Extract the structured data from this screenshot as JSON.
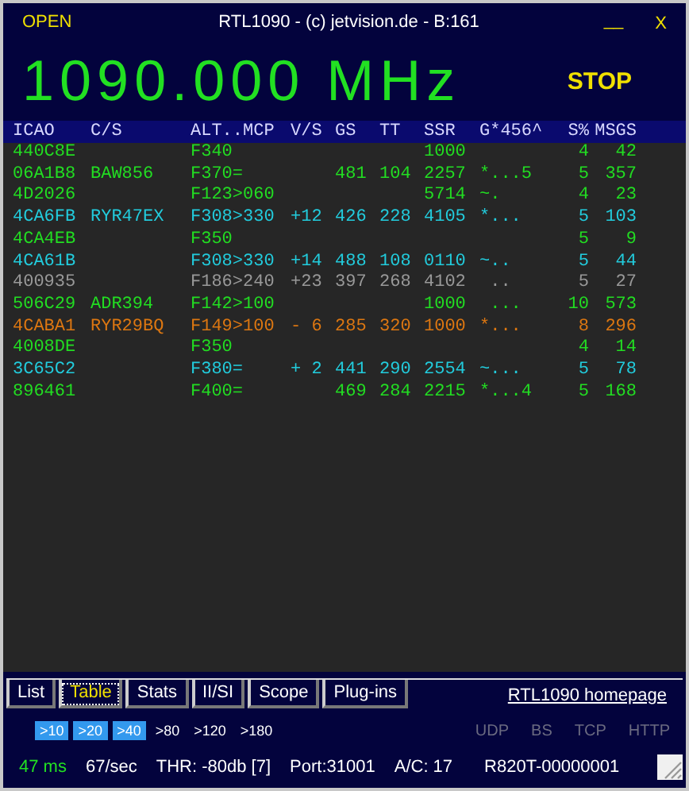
{
  "window": {
    "title": "RTL1090 - (c) jetvision.de - B:161",
    "open_label": "OPEN",
    "minimize_label": "__",
    "close_label": "X"
  },
  "frequency": "1090.000 MHz",
  "stop_label": "STOP",
  "table": {
    "columns": [
      "ICAO",
      "C/S",
      "ALT..MCP",
      "V/S",
      "GS",
      "TT",
      "SSR",
      "G*456^",
      "S%",
      "MSGS"
    ],
    "rows": [
      {
        "color": "#22dd22",
        "cells": [
          "440C8E",
          "",
          "F340",
          "",
          "",
          "",
          "1000",
          "",
          "4",
          "42"
        ]
      },
      {
        "color": "#22dd22",
        "cells": [
          "06A1B8",
          "BAW856",
          "F370=",
          "",
          "481",
          "104",
          "2257",
          "*...5",
          "5",
          "357"
        ]
      },
      {
        "color": "#22dd22",
        "cells": [
          "4D2026",
          "",
          "F123>060",
          "",
          "",
          "",
          "5714",
          "~.",
          "4",
          "23"
        ]
      },
      {
        "color": "#22ccdd",
        "cells": [
          "4CA6FB",
          "RYR47EX",
          "F308>330",
          "+12",
          "426",
          "228",
          "4105",
          "*...",
          "5",
          "103"
        ]
      },
      {
        "color": "#22dd22",
        "cells": [
          "4CA4EB",
          "",
          "F350",
          "",
          "",
          "",
          "",
          "",
          "5",
          "9"
        ]
      },
      {
        "color": "#22ccdd",
        "cells": [
          "4CA61B",
          "",
          "F308>330",
          "+14",
          "488",
          "108",
          "0110",
          "~..",
          "5",
          "44"
        ]
      },
      {
        "color": "#999999",
        "cells": [
          "400935",
          "",
          "F186>240",
          "+23",
          "397",
          "268",
          "4102",
          " ..",
          "5",
          "27"
        ]
      },
      {
        "color": "#22dd22",
        "cells": [
          "506C29",
          "ADR394",
          "F142>100",
          "",
          "",
          "",
          "1000",
          " ...",
          "10",
          "573"
        ]
      },
      {
        "color": "#dd7711",
        "cells": [
          "4CABA1",
          "RYR29BQ",
          "F149>100",
          "- 6",
          "285",
          "320",
          "1000",
          "*...",
          "8",
          "296"
        ]
      },
      {
        "color": "#22dd22",
        "cells": [
          "4008DE",
          "",
          "F350",
          "",
          "",
          "",
          "",
          "",
          "4",
          "14"
        ]
      },
      {
        "color": "#22ccdd",
        "cells": [
          "3C65C2",
          "",
          "F380=",
          "+ 2",
          "441",
          "290",
          "2554",
          "~...",
          "5",
          "78"
        ]
      },
      {
        "color": "#22dd22",
        "cells": [
          "896461",
          "",
          "F400=",
          "",
          "469",
          "284",
          "2215",
          "*...4",
          "5",
          "168"
        ]
      }
    ]
  },
  "tabs": [
    {
      "label": "List",
      "selected": false
    },
    {
      "label": "Table",
      "selected": true
    },
    {
      "label": "Stats",
      "selected": false
    },
    {
      "label": "II/SI",
      "selected": false
    },
    {
      "label": "Scope",
      "selected": false
    },
    {
      "label": "Plug-ins",
      "selected": false
    }
  ],
  "homepage_link": "RTL1090 homepage",
  "range_filters": [
    {
      "label": ">10",
      "selected": true
    },
    {
      "label": ">20",
      "selected": true
    },
    {
      "label": ">40",
      "selected": true
    },
    {
      "label": ">80",
      "selected": false
    },
    {
      "label": ">120",
      "selected": false
    },
    {
      "label": ">180",
      "selected": false
    }
  ],
  "connections": [
    {
      "label": "UDP",
      "on": false
    },
    {
      "label": "BS",
      "on": false
    },
    {
      "label": "TCP",
      "on": false
    },
    {
      "label": "HTTP",
      "on": false
    }
  ],
  "status_bar": {
    "latency": "47 ms",
    "rate": "67/sec",
    "threshold": "THR: -80db [7]",
    "port": "Port:31001",
    "aircraft": "A/C: 17",
    "device": "R820T-00000001"
  }
}
